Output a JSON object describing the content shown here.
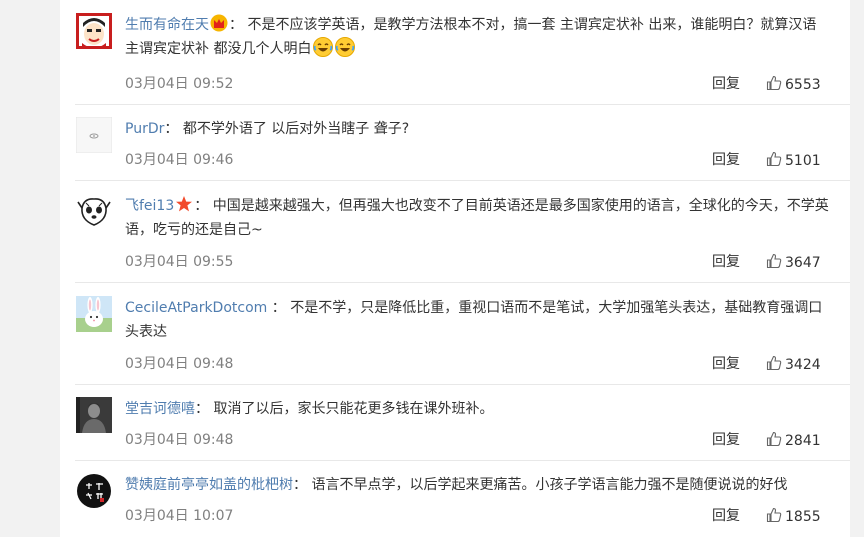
{
  "comments": [
    {
      "username": "生而有命在天",
      "badge_icon": "crown-badge-icon",
      "sep": "：",
      "text": "不是不应该学英语，是教学方法根本不对，搞一套 主谓宾定状补 出来，谁能明白？就算汉语 主谓宾定状补 都没几个人明白",
      "trailing_icons": [
        "laughing-emoji-icon",
        "laughing-emoji-icon"
      ],
      "time": "03月04日 09:52",
      "reply": "回复",
      "likes": "6553"
    },
    {
      "username": "PurDr",
      "sep": "：",
      "text": "都不学外语了 以后对外当瞎子 聋子?",
      "time": "03月04日 09:46",
      "reply": "回复",
      "likes": "5101"
    },
    {
      "username": "飞fei13",
      "badge_icon": "red-star-badge-icon",
      "sep": "：",
      "text": "中国是越来越强大，但再强大也改变不了目前英语还是最多国家使用的语言，全球化的今天，不学英语，吃亏的还是自己~",
      "time": "03月04日 09:55",
      "reply": "回复",
      "likes": "3647"
    },
    {
      "username": "CecileAtParkDotcom",
      "sep": "：",
      "text": "不是不学，只是降低比重，重视口语而不是笔试，大学加强笔头表达，基础教育强调口头表达",
      "time": "03月04日 09:48",
      "reply": "回复",
      "likes": "3424"
    },
    {
      "username": "堂吉诃德嘻",
      "sep": "：",
      "text": "取消了以后，家长只能花更多钱在课外班补。",
      "time": "03月04日 09:48",
      "reply": "回复",
      "likes": "2841"
    },
    {
      "username": "赞姨庭前亭亭如盖的枇杷树",
      "sep": "：",
      "text": "语言不早点学，以后学起来更痛苦。小孩子学语言能力强不是随便说说的好伐",
      "time": "03月04日 10:07",
      "reply": "回复",
      "likes": "1855"
    }
  ],
  "colors": {
    "username_blue": "#507daf",
    "time_gray": "#808080",
    "text": "#333333"
  },
  "like_icon": "thumbs-up-icon"
}
